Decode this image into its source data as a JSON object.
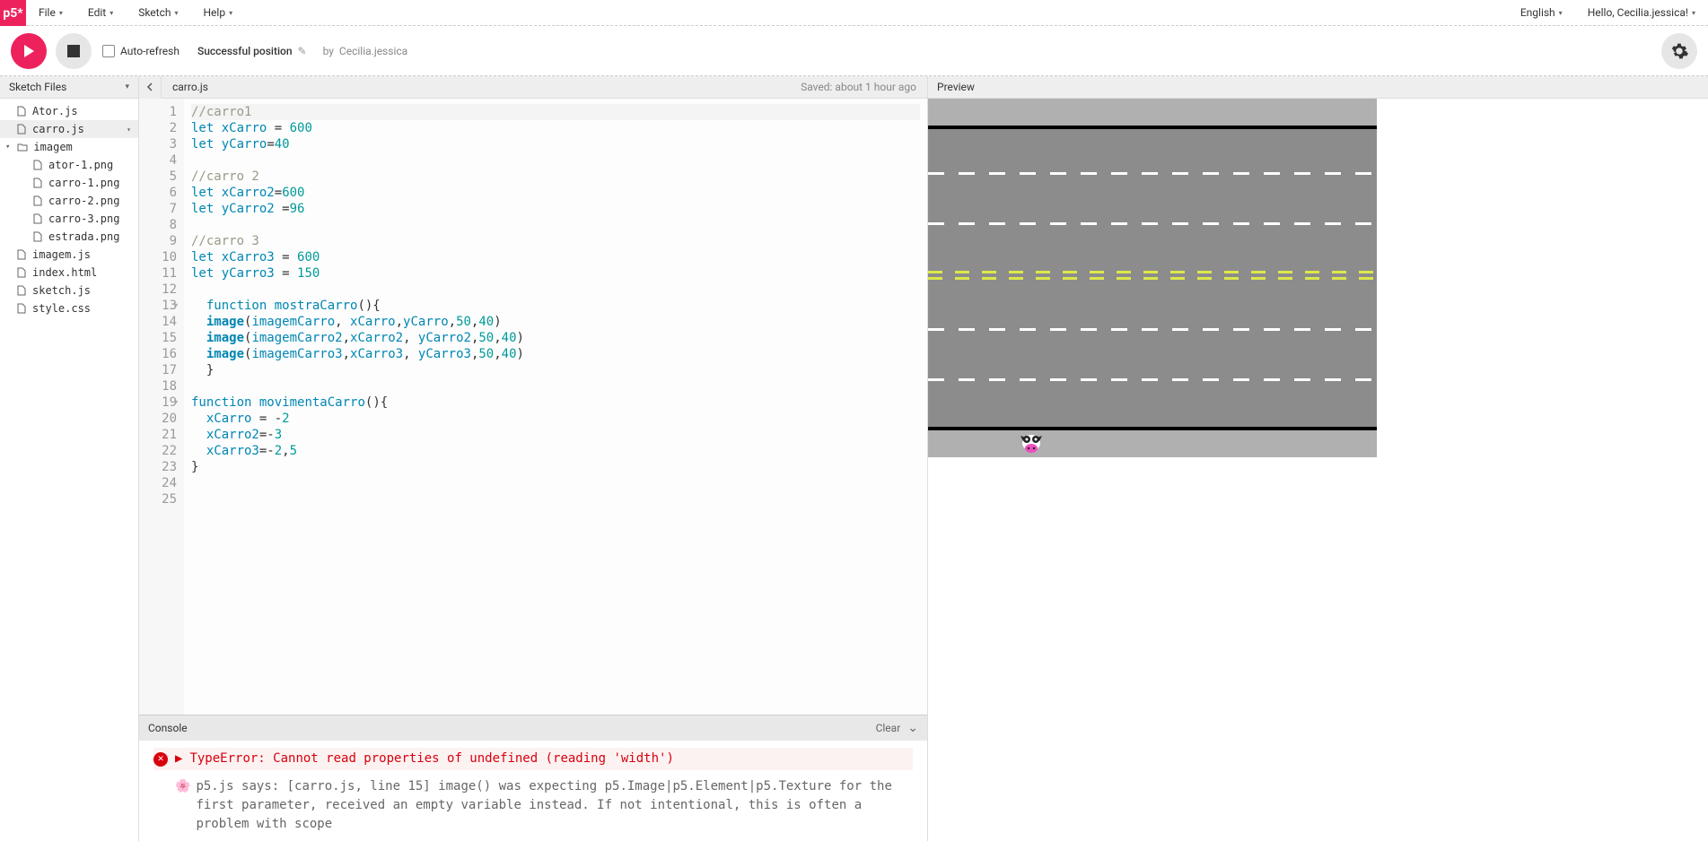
{
  "logo": "p5*",
  "menu": {
    "file": "File",
    "edit": "Edit",
    "sketch": "Sketch",
    "help": "Help"
  },
  "language": "English",
  "greeting": "Hello, Cecilia.jessica!",
  "toolbar": {
    "auto_refresh": "Auto-refresh",
    "sketch_name": "Successful position",
    "by": "by",
    "author": "Cecilia.jessica"
  },
  "sidebar": {
    "title": "Sketch Files",
    "files": [
      {
        "name": "Ator.js",
        "type": "file",
        "level": 0
      },
      {
        "name": "carro.js",
        "type": "file",
        "level": 0,
        "selected": true
      },
      {
        "name": "imagem",
        "type": "folder",
        "level": 0,
        "open": true
      },
      {
        "name": "ator-1.png",
        "type": "file",
        "level": 1
      },
      {
        "name": "carro-1.png",
        "type": "file",
        "level": 1
      },
      {
        "name": "carro-2.png",
        "type": "file",
        "level": 1
      },
      {
        "name": "carro-3.png",
        "type": "file",
        "level": 1
      },
      {
        "name": "estrada.png",
        "type": "file",
        "level": 1
      },
      {
        "name": "imagem.js",
        "type": "file",
        "level": 0
      },
      {
        "name": "index.html",
        "type": "file",
        "level": 0
      },
      {
        "name": "sketch.js",
        "type": "file",
        "level": 0
      },
      {
        "name": "style.css",
        "type": "file",
        "level": 0
      }
    ]
  },
  "editor": {
    "current_file": "carro.js",
    "saved_status": "Saved: about 1 hour ago",
    "line_count": 25,
    "fold_lines": [
      13,
      19
    ],
    "code_lines": [
      {
        "n": 1,
        "html": "<span class='com'>//carro1</span>",
        "hl": true
      },
      {
        "n": 2,
        "html": "<span class='kw'>let</span> <span class='var'>xCarro</span> = <span class='num'>600</span>"
      },
      {
        "n": 3,
        "html": "<span class='kw'>let</span> <span class='var'>yCarro</span>=<span class='num'>40</span>"
      },
      {
        "n": 4,
        "html": ""
      },
      {
        "n": 5,
        "html": "<span class='com'>//carro 2</span>"
      },
      {
        "n": 6,
        "html": "<span class='kw'>let</span> <span class='var'>xCarro2</span>=<span class='num'>600</span>"
      },
      {
        "n": 7,
        "html": "<span class='kw'>let</span> <span class='var'>yCarro2</span> =<span class='num'>96</span>"
      },
      {
        "n": 8,
        "html": ""
      },
      {
        "n": 9,
        "html": "<span class='com'>//carro 3</span>"
      },
      {
        "n": 10,
        "html": "<span class='kw'>let</span> <span class='var'>xCarro3</span> = <span class='num'>600</span>"
      },
      {
        "n": 11,
        "html": "<span class='kw'>let</span> <span class='var'>yCarro3</span> = <span class='num'>150</span>"
      },
      {
        "n": 12,
        "html": ""
      },
      {
        "n": 13,
        "html": "  <span class='kw'>function</span> <span class='fname'>mostraCarro</span>(){"
      },
      {
        "n": 14,
        "html": "  <span class='fn'>image</span>(<span class='var'>imagemCarro</span>, <span class='var'>xCarro</span>,<span class='var'>yCarro</span>,<span class='num'>50</span>,<span class='num'>40</span>)"
      },
      {
        "n": 15,
        "html": "  <span class='fn'>image</span>(<span class='var'>imagemCarro2</span>,<span class='var'>xCarro2</span>, <span class='var'>yCarro2</span>,<span class='num'>50</span>,<span class='num'>40</span>)"
      },
      {
        "n": 16,
        "html": "  <span class='fn'>image</span>(<span class='var'>imagemCarro3</span>,<span class='var'>xCarro3</span>, <span class='var'>yCarro3</span>,<span class='num'>50</span>,<span class='num'>40</span>)"
      },
      {
        "n": 17,
        "html": "  }"
      },
      {
        "n": 18,
        "html": ""
      },
      {
        "n": 19,
        "html": "<span class='kw'>function</span> <span class='fname'>movimentaCarro</span>(){"
      },
      {
        "n": 20,
        "html": "  <span class='var'>xCarro</span> = -<span class='num'>2</span>"
      },
      {
        "n": 21,
        "html": "  <span class='var'>xCarro2</span>=-<span class='num'>3</span>"
      },
      {
        "n": 22,
        "html": "  <span class='var'>xCarro3</span>=-<span class='num'>2</span>,<span class='num'>5</span>"
      },
      {
        "n": 23,
        "html": "}"
      },
      {
        "n": 24,
        "html": ""
      },
      {
        "n": 25,
        "html": ""
      }
    ]
  },
  "console": {
    "title": "Console",
    "clear": "Clear",
    "error": "TypeError: Cannot read properties of undefined (reading 'width')",
    "friendly": "p5.js says: [carro.js, line 15] image() was expecting p5.Image|p5.Element|p5.Texture for the first parameter, received an empty variable instead. If not intentional, this is often a problem with scope",
    "flower": "🌸"
  },
  "preview": {
    "title": "Preview"
  }
}
